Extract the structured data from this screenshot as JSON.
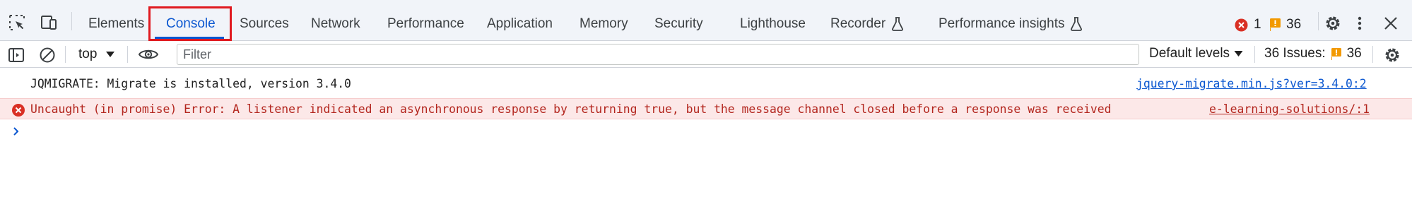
{
  "tabs": [
    {
      "label": "Elements"
    },
    {
      "label": "Console",
      "active": true
    },
    {
      "label": "Sources"
    },
    {
      "label": "Network"
    },
    {
      "label": "Performance"
    },
    {
      "label": "Application"
    },
    {
      "label": "Memory"
    },
    {
      "label": "Security"
    },
    {
      "label": "Lighthouse"
    },
    {
      "label": "Recorder",
      "experimental_icon": "flask-icon"
    },
    {
      "label": "Performance insights",
      "experimental_icon": "flask-icon"
    }
  ],
  "counters": {
    "errors": "1",
    "warnings": "36",
    "error_icon": "error-icon",
    "warning_icon": "warning-flag-icon"
  },
  "toolbar": {
    "context": "top",
    "filter_placeholder": "Filter",
    "filter_value": "",
    "levels": "Default levels",
    "issues_label": "36 Issues:",
    "issues_count": "36"
  },
  "messages": [
    {
      "level": "log",
      "text": "JQMIGRATE: Migrate is installed, version 3.4.0",
      "source": "jquery-migrate.min.js?ver=3.4.0:2"
    },
    {
      "level": "error",
      "text": "Uncaught (in promise) Error: A listener indicated an asynchronous response by returning true, but the message channel closed before a response was received",
      "source": "e-learning-solutions/:1"
    }
  ],
  "colors": {
    "accent": "#0b57d0",
    "error": "#b3261e",
    "error_background": "#fce8e8",
    "warning": "#f29900",
    "highlight_box": "#e0191f"
  }
}
